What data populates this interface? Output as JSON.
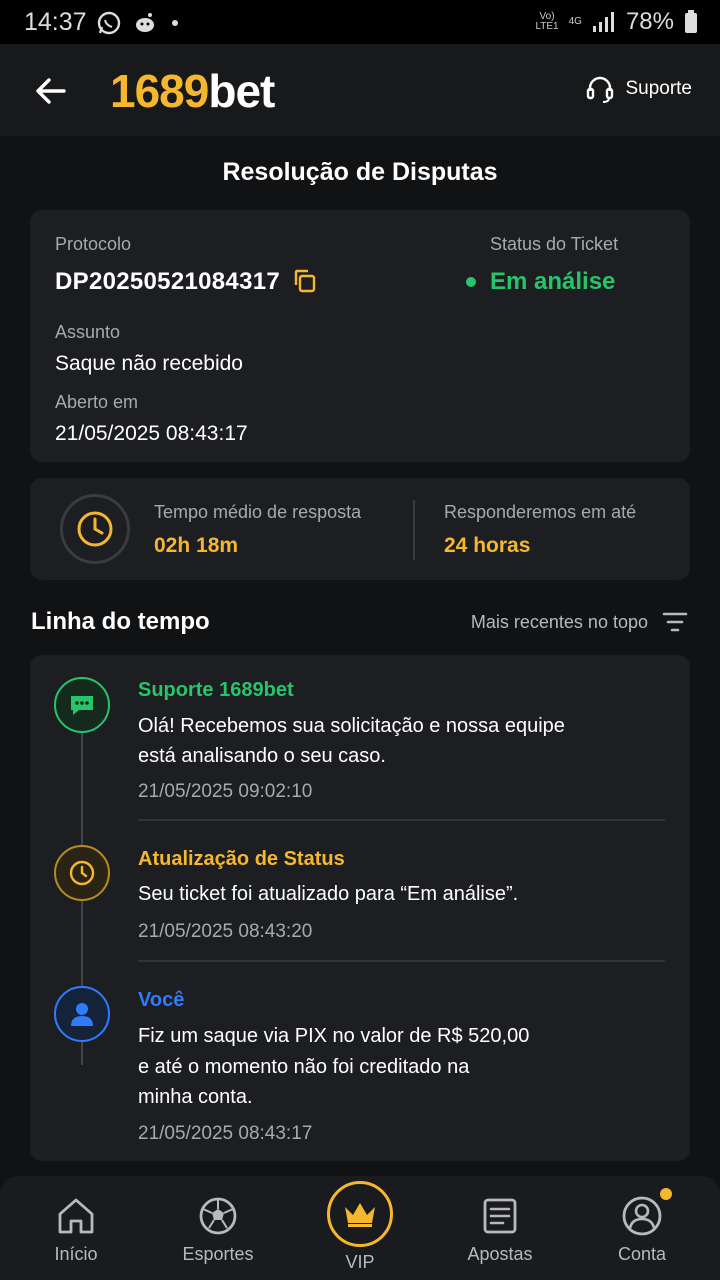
{
  "status_bar": {
    "time": "14:37",
    "network_top": "Vo)",
    "network_bottom": "LTE1",
    "net_type": "4G",
    "battery": "78%"
  },
  "header": {
    "logo_number": "1689",
    "logo_text": "bet",
    "support_label": "Suporte"
  },
  "page_title": "Resolução de Disputas",
  "ticket": {
    "protocol_label": "Protocolo",
    "protocol_value": "DP20250521084317",
    "status_label": "Status do Ticket",
    "status_value": "Em análise",
    "subject_label": "Assunto",
    "subject_value": "Saque não recebido",
    "opened_label": "Aberto em",
    "opened_value": "21/05/2025 08:43:17"
  },
  "response": {
    "avg_label": "Tempo médio de resposta",
    "avg_value": "02h 18m",
    "within_label": "Responderemos em até",
    "within_value": "24 horas"
  },
  "timeline": {
    "title": "Linha do tempo",
    "sort_label": "Mais recentes no topo",
    "entries": [
      {
        "author": "Suporte 1689bet",
        "lines": [
          "Olá! Recebemos sua solicitação e nossa equipe",
          "está analisando o seu caso."
        ],
        "time": "21/05/2025 09:02:10",
        "color": "#27c46a",
        "icon": "chat-icon"
      },
      {
        "author": "Atualização de Status",
        "lines": [
          "Seu ticket foi atualizado para “Em análise”."
        ],
        "time": "21/05/2025 08:43:20",
        "color": "#f5b72d",
        "icon": "clock-icon"
      },
      {
        "author": "Você",
        "lines": [
          "Fiz um saque via PIX no valor de R$ 520,00",
          "e até o momento não foi creditado na",
          "minha conta."
        ],
        "time": "21/05/2025 08:43:17",
        "color": "#2f7cf6",
        "icon": "user-icon"
      }
    ]
  },
  "nav": {
    "home": "Início",
    "sports": "Esportes",
    "vip": "VIP",
    "bets": "Apostas",
    "account": "Conta"
  },
  "colors": {
    "accent": "#f5b72d",
    "success": "#27c46a",
    "user": "#2f7cf6"
  }
}
